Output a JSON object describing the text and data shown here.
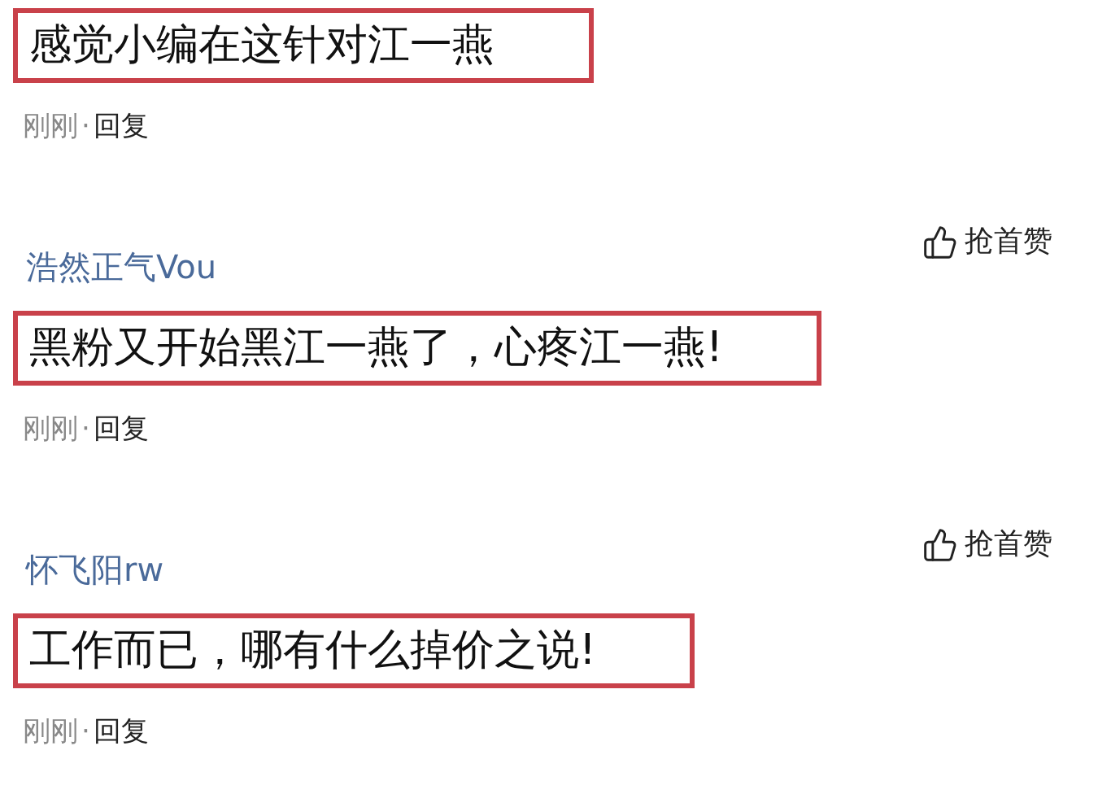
{
  "comments": [
    {
      "text": "感觉小编在这针对江一燕",
      "highlighted": true,
      "time": "刚刚",
      "separator": "·",
      "reply": "回复"
    },
    {
      "user": "浩然正气Vou",
      "like": "抢首赞",
      "text": "黑粉又开始黑江一燕了，心疼江一燕!",
      "highlighted": true,
      "time": "刚刚",
      "separator": "·",
      "reply": "回复"
    },
    {
      "user": "怀飞阳rw",
      "like": "抢首赞",
      "text": "工作而已，哪有什么掉价之说!",
      "highlighted": true,
      "time": "刚刚",
      "separator": "·",
      "reply": "回复"
    }
  ]
}
